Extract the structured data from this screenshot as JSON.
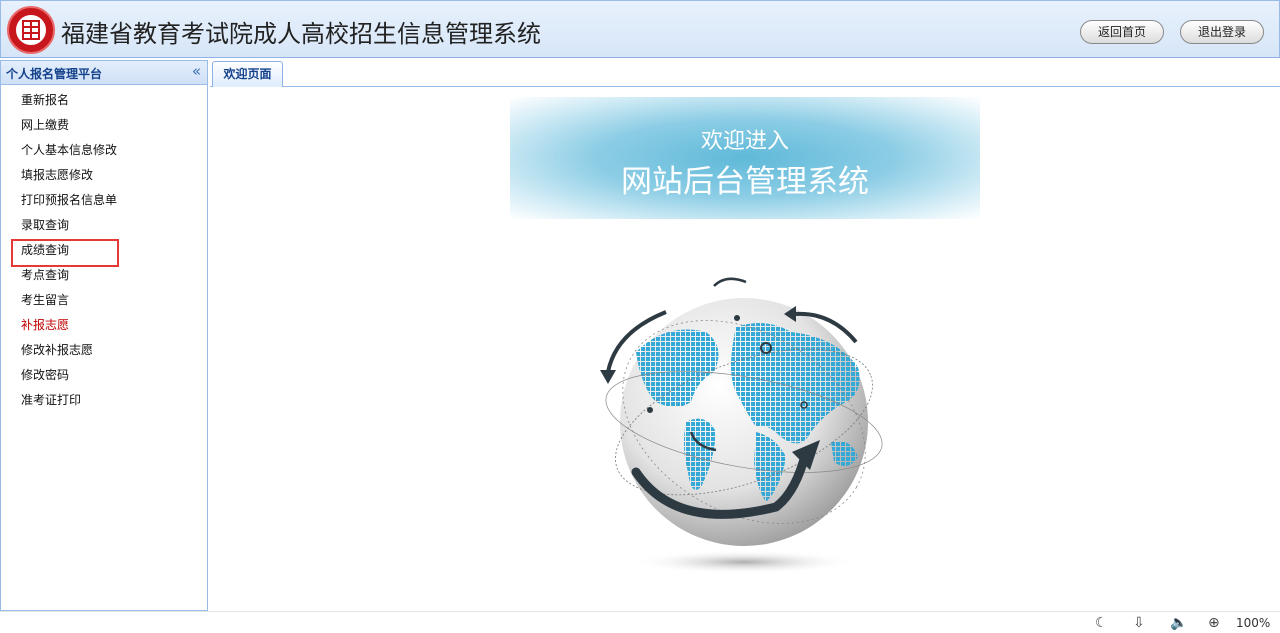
{
  "header": {
    "title": "福建省教育考试院成人高校招生信息管理系统",
    "logo_glyph": "",
    "buttons": {
      "home": "返回首页",
      "logout": "退出登录"
    }
  },
  "sidebar": {
    "title": "个人报名管理平台",
    "collapse_glyph": "«",
    "items": [
      {
        "label": "重新报名"
      },
      {
        "label": "网上缴费"
      },
      {
        "label": "个人基本信息修改"
      },
      {
        "label": "填报志愿修改"
      },
      {
        "label": "打印预报名信息单"
      },
      {
        "label": "录取查询"
      },
      {
        "label": "成绩查询"
      },
      {
        "label": "考点查询"
      },
      {
        "label": "考生留言"
      },
      {
        "label": "补报志愿"
      },
      {
        "label": "修改补报志愿"
      },
      {
        "label": "修改密码"
      },
      {
        "label": "准考证打印"
      }
    ]
  },
  "tabs": [
    {
      "label": "欢迎页面"
    }
  ],
  "banner": {
    "line1": "欢迎进入",
    "line2": "网站后台管理系统"
  },
  "statusbar": {
    "zoom": "100%"
  },
  "colors": {
    "accent": "#15428b",
    "highlight_box": "#e53935",
    "red_item": "#c00000",
    "banner": "#5fb9d9"
  }
}
